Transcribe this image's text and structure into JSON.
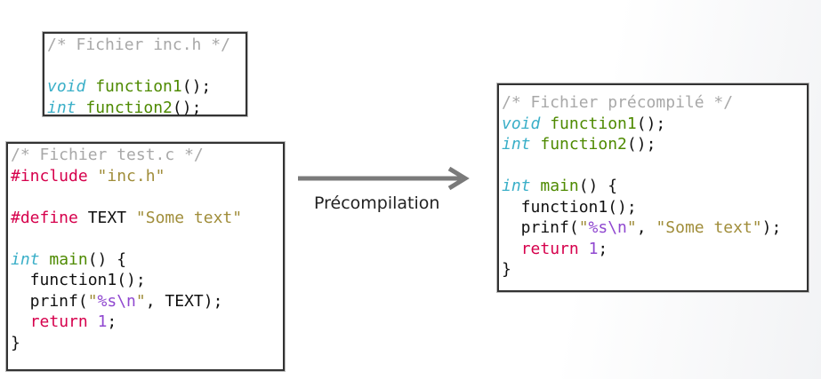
{
  "files": {
    "inc": {
      "lines": [
        [
          [
            "c",
            "/* Fichier inc.h */"
          ]
        ],
        [],
        [
          [
            "k",
            "void"
          ],
          [
            "d",
            " "
          ],
          [
            "f",
            "function1"
          ],
          [
            "d",
            "();"
          ]
        ],
        [
          [
            "k",
            "int"
          ],
          [
            "d",
            " "
          ],
          [
            "f",
            "function2"
          ],
          [
            "d",
            "();"
          ]
        ]
      ]
    },
    "test": {
      "lines": [
        [
          [
            "c",
            "/* Fichier test.c */"
          ]
        ],
        [
          [
            "p",
            "#include"
          ],
          [
            "d",
            " "
          ],
          [
            "s",
            "\"inc.h\""
          ]
        ],
        [],
        [
          [
            "p",
            "#define"
          ],
          [
            "d",
            " TEXT "
          ],
          [
            "s",
            "\"Some text\""
          ]
        ],
        [],
        [
          [
            "k",
            "int"
          ],
          [
            "d",
            " "
          ],
          [
            "f",
            "main"
          ],
          [
            "d",
            "() {"
          ]
        ],
        [
          [
            "d",
            "  function1();"
          ]
        ],
        [
          [
            "d",
            "  prinf("
          ],
          [
            "s",
            "\""
          ],
          [
            "n",
            "%s\\n"
          ],
          [
            "s",
            "\""
          ],
          [
            "d",
            ", TEXT);"
          ]
        ],
        [
          [
            "d",
            "  "
          ],
          [
            "p",
            "return"
          ],
          [
            "d",
            " "
          ],
          [
            "n",
            "1"
          ],
          [
            "d",
            ";"
          ]
        ],
        [
          [
            "d",
            "}"
          ]
        ]
      ]
    },
    "pre": {
      "lines": [
        [
          [
            "c",
            "/* Fichier précompilé */"
          ]
        ],
        [
          [
            "k",
            "void"
          ],
          [
            "d",
            " "
          ],
          [
            "f",
            "function1"
          ],
          [
            "d",
            "();"
          ]
        ],
        [
          [
            "k",
            "int"
          ],
          [
            "d",
            " "
          ],
          [
            "f",
            "function2"
          ],
          [
            "d",
            "();"
          ]
        ],
        [],
        [
          [
            "k",
            "int"
          ],
          [
            "d",
            " "
          ],
          [
            "f",
            "main"
          ],
          [
            "d",
            "() {"
          ]
        ],
        [
          [
            "d",
            "  function1();"
          ]
        ],
        [
          [
            "d",
            "  prinf("
          ],
          [
            "s",
            "\""
          ],
          [
            "n",
            "%s\\n"
          ],
          [
            "s",
            "\""
          ],
          [
            "d",
            ", "
          ],
          [
            "s",
            "\"Some text\""
          ],
          [
            "d",
            ");"
          ]
        ],
        [
          [
            "d",
            "  "
          ],
          [
            "p",
            "return"
          ],
          [
            "d",
            " "
          ],
          [
            "n",
            "1"
          ],
          [
            "d",
            ";"
          ]
        ],
        [
          [
            "d",
            "}"
          ]
        ]
      ]
    }
  },
  "arrow": {
    "label": "Précompilation",
    "color": "#7a7a7a"
  }
}
